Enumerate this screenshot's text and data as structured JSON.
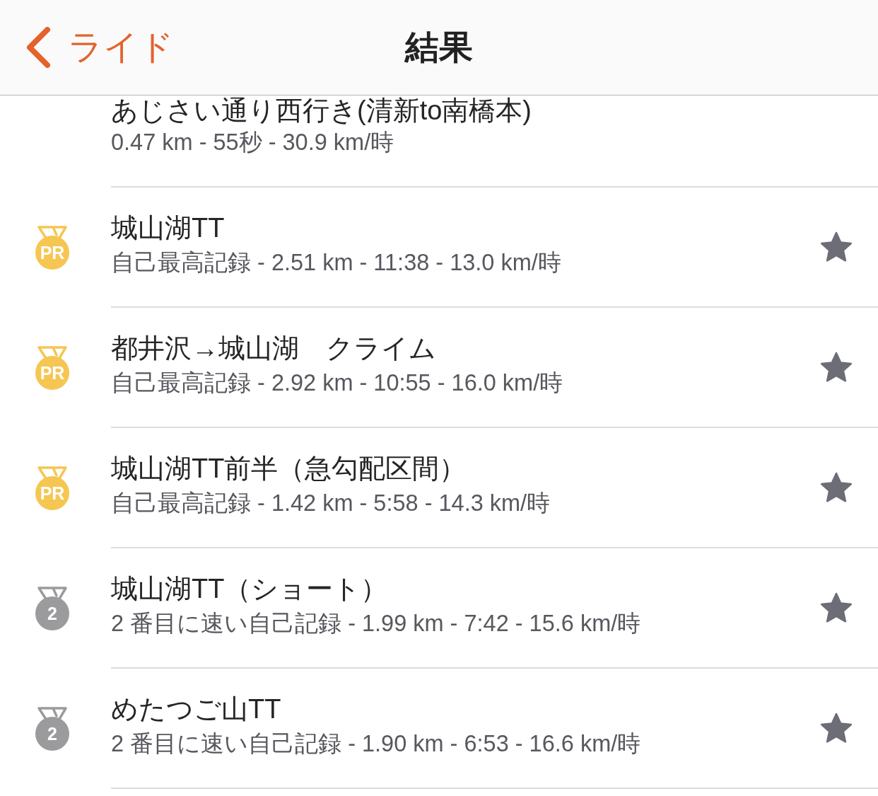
{
  "nav": {
    "back_label": "ライド",
    "title": "結果"
  },
  "segments": [
    {
      "name": "あじさい通り西行き(清新to南橋本)",
      "stats": "0.47 km - 55秒 - 30.9 km/時",
      "starred": false
    },
    {
      "name": "城山湖TT",
      "stats": "自己最高記録 - 2.51 km - 11:38 - 13.0 km/時",
      "medal": {
        "kind": "pr",
        "label": "PR"
      },
      "starred": true
    },
    {
      "name": "都井沢→城山湖　クライム",
      "stats": "自己最高記録 - 2.92 km - 10:55 - 16.0 km/時",
      "medal": {
        "kind": "pr",
        "label": "PR"
      },
      "starred": true
    },
    {
      "name": "城山湖TT前半（急勾配区間）",
      "stats": "自己最高記録 - 1.42 km - 5:58 - 14.3 km/時",
      "medal": {
        "kind": "pr",
        "label": "PR"
      },
      "starred": true
    },
    {
      "name": "城山湖TT（ショート）",
      "stats": "2 番目に速い自己記録 - 1.99 km - 7:42 - 15.6 km/時",
      "medal": {
        "kind": "second",
        "label": "2"
      },
      "starred": true
    },
    {
      "name": "めたつご山TT",
      "stats": "2 番目に速い自己記録 - 1.90 km - 6:53 - 16.6 km/時",
      "medal": {
        "kind": "second",
        "label": "2"
      },
      "starred": true
    }
  ]
}
